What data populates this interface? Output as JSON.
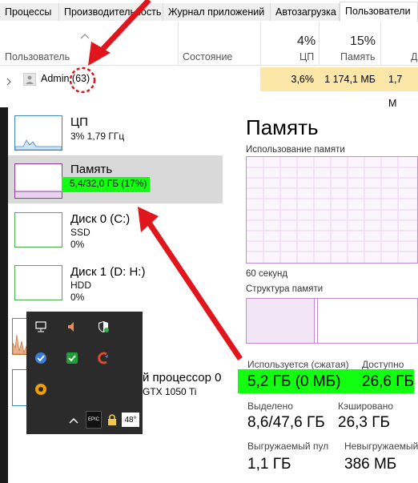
{
  "tabs": [
    {
      "label": "Процессы"
    },
    {
      "label": "Производительность"
    },
    {
      "label": "Журнал приложений"
    },
    {
      "label": "Автозагрузка"
    },
    {
      "label": "Пользователи"
    }
  ],
  "users_table": {
    "col_user": "Пользователь",
    "col_state": "Состояние",
    "cpu_pct": "4%",
    "cpu_label": "ЦП",
    "mem_pct": "15%",
    "mem_label": "Память",
    "disk_label": "Д",
    "row": {
      "name": "Admin",
      "count": "(63)",
      "cpu": "3,6%",
      "mem": "1 174,1 МБ",
      "disk": "1,7 М"
    }
  },
  "sidebar": {
    "cpu": {
      "title": "ЦП",
      "sub": "3% 1,79 ГГц"
    },
    "mem": {
      "title": "Память",
      "sub": "5,4/32,0 ГБ (17%)"
    },
    "disk0": {
      "title": "Диск 0 (C:)",
      "sub1": "SSD",
      "sub2": "0%"
    },
    "disk1": {
      "title": "Диск 1 (D: H:)",
      "sub1": "HDD",
      "sub2": "0%"
    },
    "gpu_partial": {
      "title": "й процессор 0",
      "sub": "GTX 1050 Ti",
      "sub_prefix": "ЦЬ"
    }
  },
  "memory_panel": {
    "title": "Память",
    "usage_label": "Использование памяти",
    "seconds_label": "60 секунд",
    "structure_label": "Структура памяти",
    "in_use_label": "Используется (сжатая)",
    "in_use_value": "5,2 ГБ (0 МБ)",
    "available_label": "Доступно",
    "available_value": "26,6 ГБ",
    "committed_label": "Выделено",
    "committed_value": "8,6/47,6 ГБ",
    "cached_label": "Кэшировано",
    "cached_value": "26,3 ГБ",
    "paged_label": "Выгружаемый пул",
    "paged_value": "1,1 ГБ",
    "nonpaged_label": "Невыгружаемый пул",
    "nonpaged_value": "386 МБ"
  },
  "tray": {
    "epic_label": "EPIC",
    "temp_label": "48°"
  },
  "colors": {
    "highlight_green": "#12ff12",
    "annotation_red": "#e0161c",
    "heat_yellow": "#fde7a8",
    "memory_purple": "#8b3a9c"
  }
}
